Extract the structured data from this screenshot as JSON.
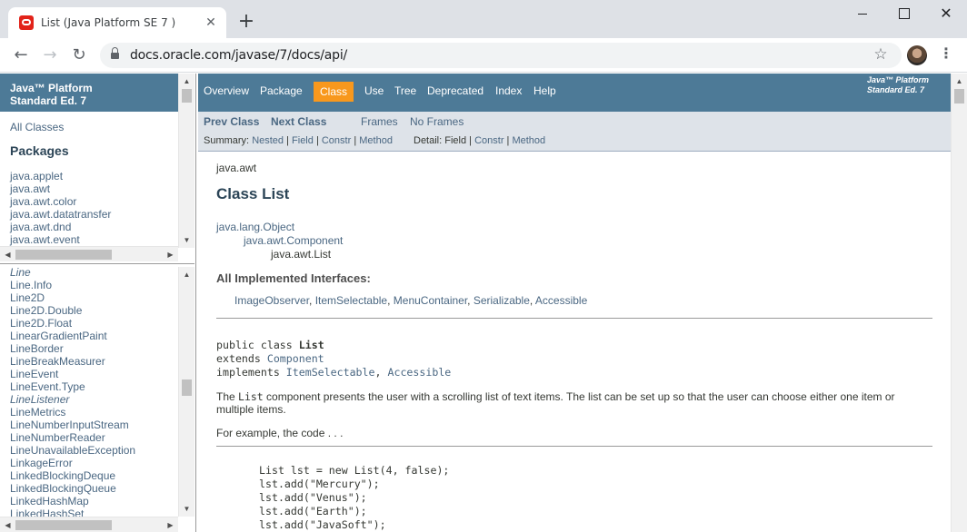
{
  "browser": {
    "tab_title": "List (Java Platform SE 7 )",
    "tab_close": "✕",
    "new_tab": "+",
    "url": "docs.oracle.com/javase/7/docs/api/",
    "window_close": "✕"
  },
  "left": {
    "header_line1": "Java™ Platform",
    "header_line2": "Standard Ed. 7",
    "all_classes": "All Classes",
    "packages_title": "Packages",
    "packages": [
      "java.applet",
      "java.awt",
      "java.awt.color",
      "java.awt.datatransfer",
      "java.awt.dnd",
      "java.awt.event"
    ],
    "classes": [
      {
        "name": "Line",
        "iface": true
      },
      {
        "name": "Line.Info",
        "iface": false
      },
      {
        "name": "Line2D",
        "iface": false
      },
      {
        "name": "Line2D.Double",
        "iface": false
      },
      {
        "name": "Line2D.Float",
        "iface": false
      },
      {
        "name": "LinearGradientPaint",
        "iface": false
      },
      {
        "name": "LineBorder",
        "iface": false
      },
      {
        "name": "LineBreakMeasurer",
        "iface": false
      },
      {
        "name": "LineEvent",
        "iface": false
      },
      {
        "name": "LineEvent.Type",
        "iface": false
      },
      {
        "name": "LineListener",
        "iface": true
      },
      {
        "name": "LineMetrics",
        "iface": false
      },
      {
        "name": "LineNumberInputStream",
        "iface": false
      },
      {
        "name": "LineNumberReader",
        "iface": false
      },
      {
        "name": "LineUnavailableException",
        "iface": false
      },
      {
        "name": "LinkageError",
        "iface": false
      },
      {
        "name": "LinkedBlockingDeque",
        "iface": false
      },
      {
        "name": "LinkedBlockingQueue",
        "iface": false
      },
      {
        "name": "LinkedHashMap",
        "iface": false
      },
      {
        "name": "LinkedHashSet",
        "iface": false
      }
    ]
  },
  "nav": {
    "overview": "Overview",
    "package": "Package",
    "class": "Class",
    "use": "Use",
    "tree": "Tree",
    "deprecated": "Deprecated",
    "index": "Index",
    "help": "Help",
    "about_line1": "Java™ Platform",
    "about_line2": "Standard Ed. 7",
    "prev_class": "Prev Class",
    "next_class": "Next Class",
    "frames": "Frames",
    "no_frames": "No Frames",
    "summary_label": "Summary:",
    "summary_nested": "Nested",
    "summary_field": "Field",
    "summary_constr": "Constr",
    "summary_method": "Method",
    "detail_label": "Detail:",
    "detail_field": "Field",
    "detail_constr": "Constr",
    "detail_method": "Method",
    "sep": "|"
  },
  "content": {
    "package": "java.awt",
    "title": "Class List",
    "inheritance": [
      "java.lang.Object",
      "java.awt.Component",
      "java.awt.List"
    ],
    "impl_heading": "All Implemented Interfaces:",
    "interfaces": [
      "ImageObserver",
      "ItemSelectable",
      "MenuContainer",
      "Serializable",
      "Accessible"
    ],
    "interface_sep": ", ",
    "decl_public": "public class ",
    "decl_name": "List",
    "decl_extends": "extends ",
    "decl_super": "Component",
    "decl_implements": "implements ",
    "decl_if1": "ItemSelectable",
    "decl_comma": ", ",
    "decl_if2": "Accessible",
    "desc_pre": "The ",
    "desc_code": "List",
    "desc_post": " component presents the user with a scrolling list of text items. The list can be set up so that the user can choose either one item or multiple items.",
    "example": "For example, the code . . .",
    "code_lines": [
      "List lst = new List(4, false);",
      "lst.add(\"Mercury\");",
      "lst.add(\"Venus\");",
      "lst.add(\"Earth\");",
      "lst.add(\"JavaSoft\");"
    ]
  },
  "colors": {
    "nav_bg": "#4d7a97",
    "active_tab": "#f8981d",
    "subnav_bg": "#dee3e9",
    "link": "#4a6782"
  }
}
